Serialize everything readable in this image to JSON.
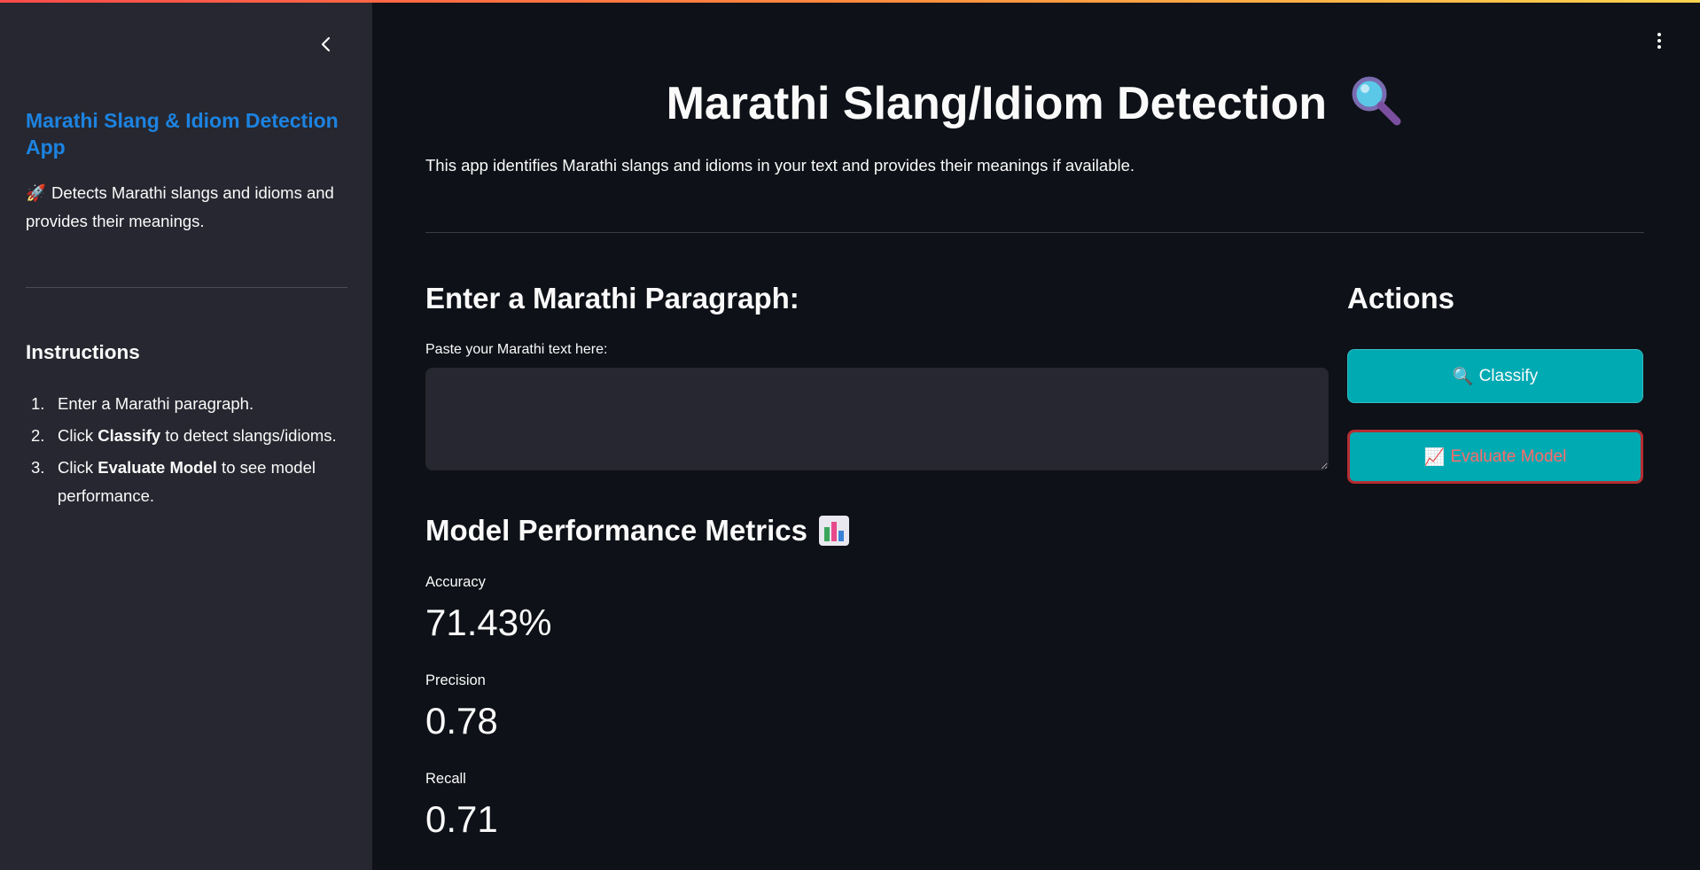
{
  "sidebar": {
    "title": "Marathi Slang & Idiom Detection App",
    "description": "Detects Marathi slangs and idioms and provides their meanings.",
    "instructions_title": "Instructions",
    "instructions": [
      {
        "num": "1.",
        "pre": "Enter a Marathi paragraph.",
        "bold": "",
        "post": ""
      },
      {
        "num": "2.",
        "pre": "Click ",
        "bold": "Classify",
        "post": " to detect slangs/idioms."
      },
      {
        "num": "3.",
        "pre": "Click ",
        "bold": "Evaluate Model",
        "post": " to see model performance."
      }
    ]
  },
  "main": {
    "title": "Marathi Slang/Idiom Detection",
    "description": "This app identifies Marathi slangs and idioms in your text and provides their meanings if available.",
    "input_heading": "Enter a Marathi Paragraph:",
    "input_label": "Paste your Marathi text here:",
    "input_value": "",
    "actions_heading": "Actions",
    "classify_label": "Classify",
    "evaluate_label": "Evaluate Model",
    "metrics_heading": "Model Performance Metrics",
    "metrics": [
      {
        "label": "Accuracy",
        "value": "71.43%"
      },
      {
        "label": "Precision",
        "value": "0.78"
      },
      {
        "label": "Recall",
        "value": "0.71"
      }
    ]
  },
  "icons": {
    "collapse": "chevron-left-icon",
    "menu": "more-vertical-icon",
    "title": "magnifying-glass-icon",
    "rocket": "rocket-icon",
    "classify": "magnifying-glass-icon",
    "evaluate": "chart-increasing-icon",
    "metrics": "bar-chart-icon"
  },
  "colors": {
    "background": "#0e1117",
    "sidebar": "#262730",
    "accent_link": "#1c83e1",
    "button": "#00aab3",
    "focus_border": "#b52d32",
    "evaluate_text": "#ff6b6b"
  }
}
